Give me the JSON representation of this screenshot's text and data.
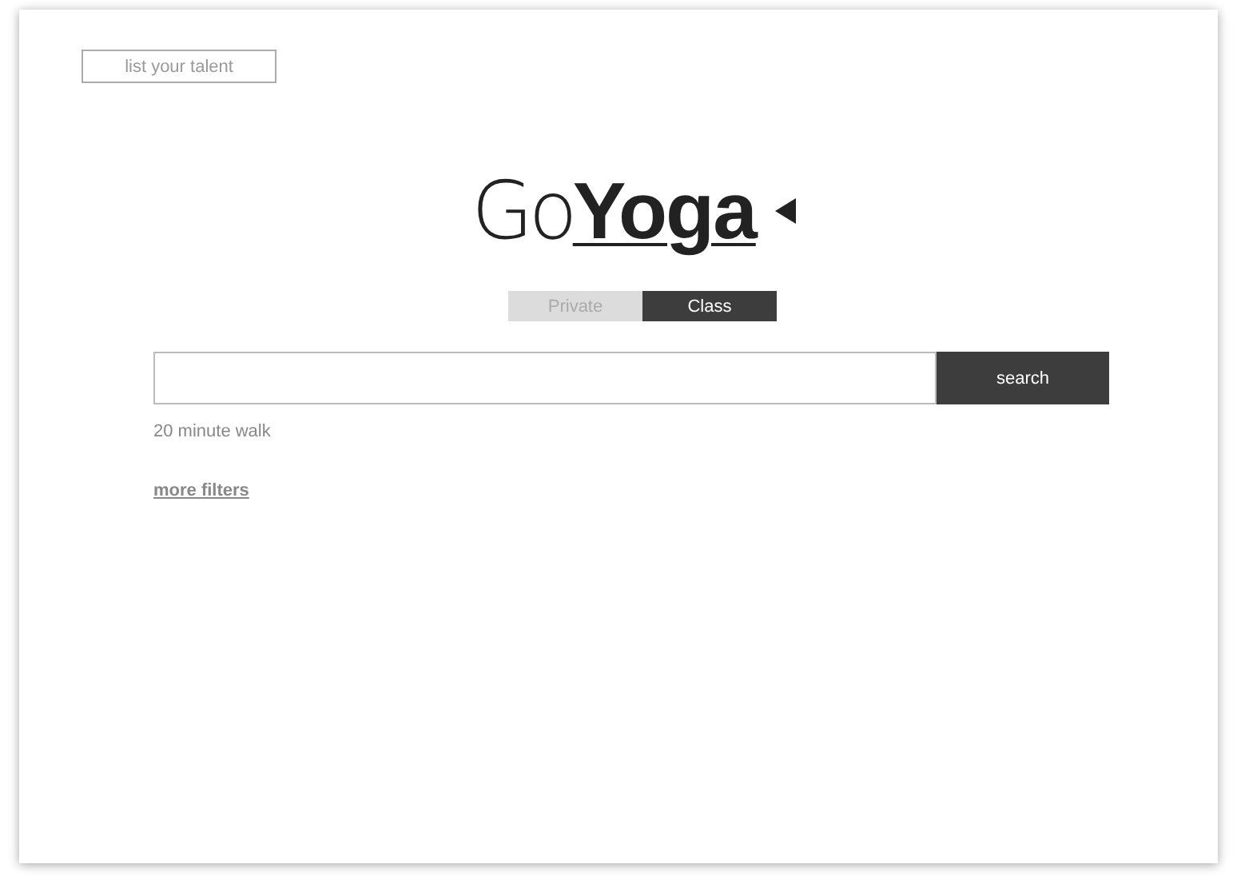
{
  "header_button": {
    "label": "list your talent"
  },
  "logo": {
    "light": "Go",
    "bold": "Yoga"
  },
  "tabs": [
    {
      "label": "Private",
      "selected": false
    },
    {
      "label": "Class",
      "selected": true
    }
  ],
  "search": {
    "button": "search"
  },
  "distance": "20 minute walk",
  "more_filters": "more filters"
}
